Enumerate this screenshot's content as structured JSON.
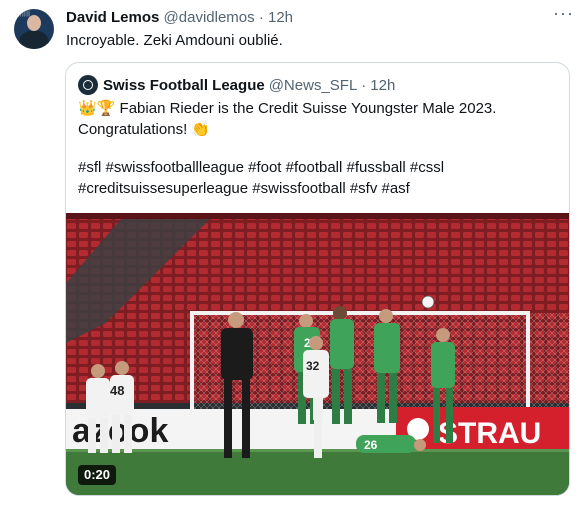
{
  "tweet": {
    "author": "David Lemos",
    "handle": "@davidlemos",
    "separator": "·",
    "time": "12h",
    "text": "Incroyable. Zeki Amdouni oublié.",
    "more_icon": "more-dots-icon"
  },
  "quoted": {
    "author": "Swiss Football League",
    "handle": "@News_SFL",
    "separator": "·",
    "time": "12h",
    "line1": "Fabian Rieder is the Credit Suisse Youngster Male 2023.",
    "line2": "Congratulations!",
    "hashtags1": "#sfl #swissfootballleague #foot #football #fussball #cssl",
    "hashtags2": "#creditsuissesuperleague #swissfootball #sfv #asf",
    "emoji_crown": "👑",
    "emoji_trophy": "🏆",
    "emoji_clap": "👏"
  },
  "video": {
    "duration": "0:20",
    "board_left": "azook",
    "board_right": "STRAU",
    "player_numbers": [
      "48",
      "32",
      "23",
      "26"
    ]
  },
  "colors": {
    "seats": "#a7262b",
    "pitch": "#3f7a3a",
    "green_kit": "#3fa35a"
  }
}
